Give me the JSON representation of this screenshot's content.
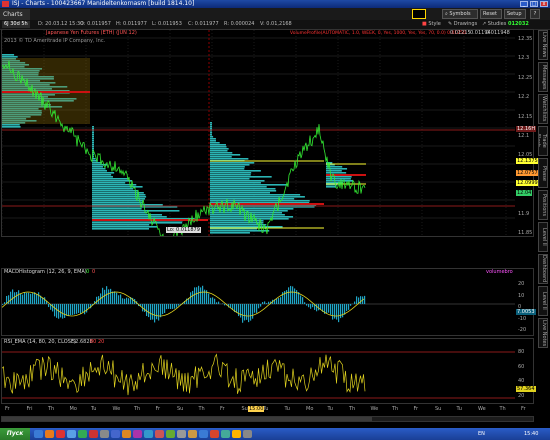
{
  "window": {
    "title": "ISJ - Charts - 100423667 Manideltenkornasm [build 1814.10]"
  },
  "menubar": {
    "tab": "Charts",
    "buttons": [
      "Symbols",
      "Reset",
      "Setup"
    ],
    "help": "?"
  },
  "toolbar": {
    "symbol": "6J 30d 5h",
    "date": "D: 20.03.12 15:30",
    "open": "O: 0.011957",
    "high": "H: 0.011977",
    "low": "L: 0.011953",
    "close": "C: 0.011977",
    "range": "R: 0.000024",
    "vol": "V: 0.01,2168",
    "style": "Style",
    "drawings": "Drawings",
    "studies": "Studies",
    "clock": "012032"
  },
  "price_panel": {
    "title": "Japanese Yen Futures (ETH) (JUN 12)",
    "subtitle": "2013 © TD Ameritrade IP Company, Inc.",
    "study_line": "VolumeProfile(AUTOMATIC, 1.0, WEEK, 0, Yes, 1000, Yes, Yes, 70, 0.0) 0.01250",
    "readout_1": "0.01215",
    "readout_2": "0.01194",
    "readout_3": "0.011948",
    "y_ticks": [
      "12.35",
      "12.3",
      "12.25",
      "12.2",
      "12.15",
      "12.1",
      "12.05",
      "12",
      "11.95",
      "11.9",
      "11.85"
    ],
    "price_tags": [
      {
        "text": "12.16H",
        "color": "#ffffff",
        "bg": "#6e1a1a"
      },
      {
        "text": "12.1375",
        "color": "#000",
        "bg": "#ffff33"
      },
      {
        "text": "12.07575",
        "color": "#000",
        "bg": "#ff9933"
      },
      {
        "text": "12.0999",
        "color": "#000",
        "bg": "#ffff33"
      },
      {
        "text": "12.04",
        "color": "#000",
        "bg": "#33cc66"
      }
    ],
    "lo_label": "Lo: 0.011879"
  },
  "macd_panel": {
    "title": "MACDHistogram (12, 26, 9, EMA)",
    "values": [
      "0",
      "0"
    ],
    "tag": "volumebro",
    "y_ticks": [
      "20",
      "10",
      "0",
      "-10",
      "-20"
    ],
    "value_tag": "7.0053"
  },
  "rsi_panel": {
    "title": "RSI_EMA (14, 80, 20, CLOSE)",
    "value": "52.6828",
    "bands": [
      "80",
      "20"
    ],
    "y_ticks": [
      "80",
      "60",
      "40",
      "20"
    ],
    "value_tag": "57.364"
  },
  "x_axis": {
    "labels": [
      "Fr",
      "Fri",
      "Th",
      "Mo",
      "Tu",
      "We",
      "Th",
      "Fr",
      "Su",
      "Th",
      "Fr",
      "Su",
      "Tu",
      "Tu",
      "Mo",
      "Tu",
      "Th",
      "We",
      "Th",
      "Fr",
      "Su",
      "Tu",
      "We",
      "Th",
      "Fr"
    ],
    "highlight": "15:00"
  },
  "right_tabs": [
    "Live News",
    "Messages",
    "Watchlists",
    "Trade Flash",
    "Phase",
    "Positions",
    "Level II",
    "Dashboard",
    "Level II",
    "Live Notes"
  ],
  "taskbar": {
    "start": "Пуск",
    "lang": "EN",
    "time": "15:40"
  },
  "colors": {
    "price_line": "#33e833",
    "profile_fill": "#2bb5b5",
    "poc": "#cc1111",
    "value_area": "#ffff33",
    "macd_hist": "#1fa6c6",
    "rsi_line": "#e0d21f"
  }
}
